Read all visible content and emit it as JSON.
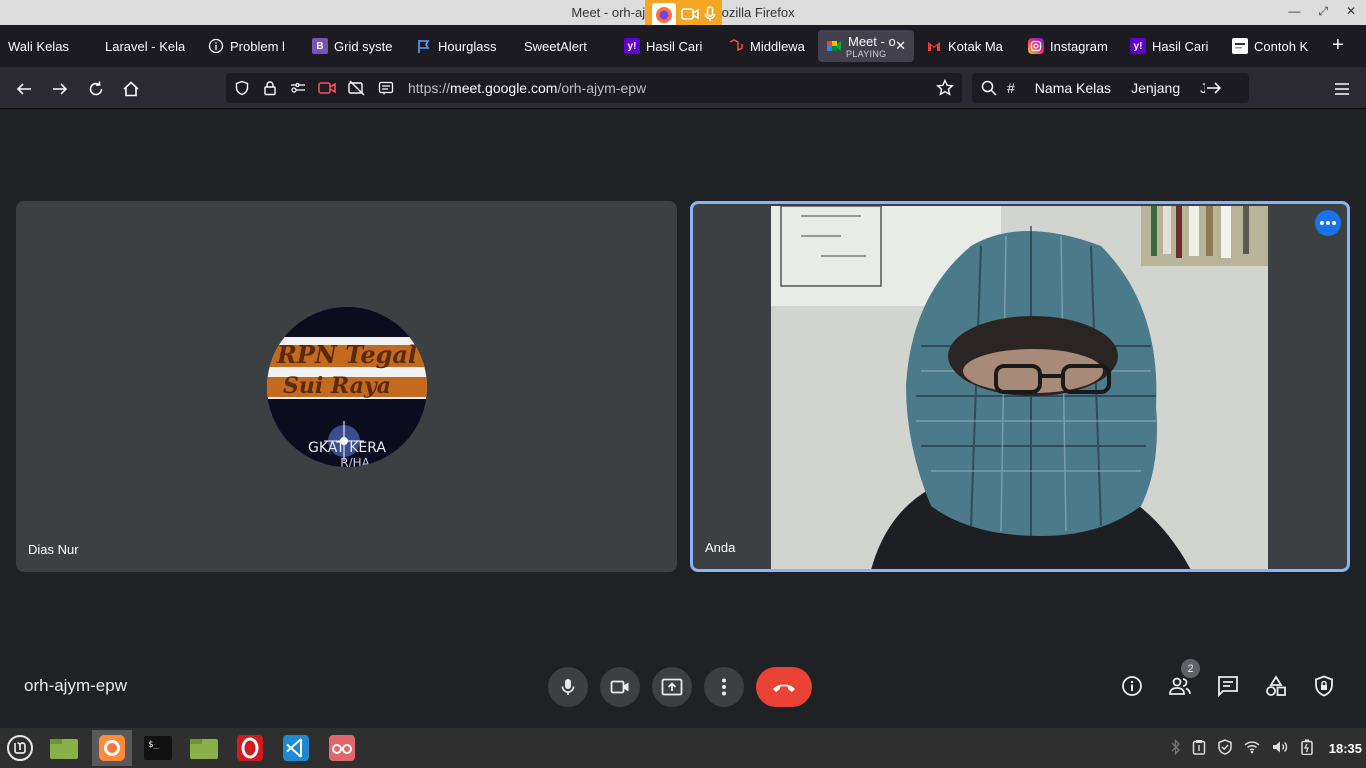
{
  "window": {
    "title": "Meet - orh-ajym-epw — Mozilla Firefox",
    "controls": [
      "minimize",
      "maximize",
      "close"
    ]
  },
  "tabs": [
    {
      "label": "Wali Kelas",
      "icon": "none"
    },
    {
      "label": "Laravel - Kela",
      "icon": "none"
    },
    {
      "label": "Problem l",
      "icon": "info-icon"
    },
    {
      "label": "Grid syste",
      "icon": "bootstrap-icon"
    },
    {
      "label": "Hourglass",
      "icon": "flag-icon"
    },
    {
      "label": "SweetAlert",
      "icon": "none"
    },
    {
      "label": "Hasil Cari",
      "icon": "yahoo-icon"
    },
    {
      "label": "Middlewa",
      "icon": "laravel-icon"
    },
    {
      "label": "Meet - o",
      "sub": "PLAYING",
      "icon": "meet-icon",
      "active": true
    },
    {
      "label": "Kotak Ma",
      "icon": "gmail-icon"
    },
    {
      "label": "Instagram",
      "icon": "instagram-icon"
    },
    {
      "label": "Hasil Cari",
      "icon": "yahoo-icon"
    },
    {
      "label": "Contoh K",
      "icon": "page-icon"
    }
  ],
  "url": {
    "prefix": "https://",
    "host": "meet.google.com",
    "path": "/orh-ajym-epw"
  },
  "search_bar": [
    "#",
    "Nama Kelas",
    "Jenjang",
    "Ju"
  ],
  "participants": [
    {
      "name": "Dias Nur",
      "avatar_text": [
        "RPN Tegal",
        "Sui Raya",
        "GKAT KERA",
        "R/HA"
      ]
    },
    {
      "name": "Anda"
    }
  ],
  "meeting_code": "orh-ajym-epw",
  "people_count": "2",
  "clock": "18:35",
  "colors": {
    "active_border": "#8ab4f8",
    "end_call": "#ea4335",
    "indicator": "#f5a623",
    "tile_bg": "#3c4043"
  }
}
